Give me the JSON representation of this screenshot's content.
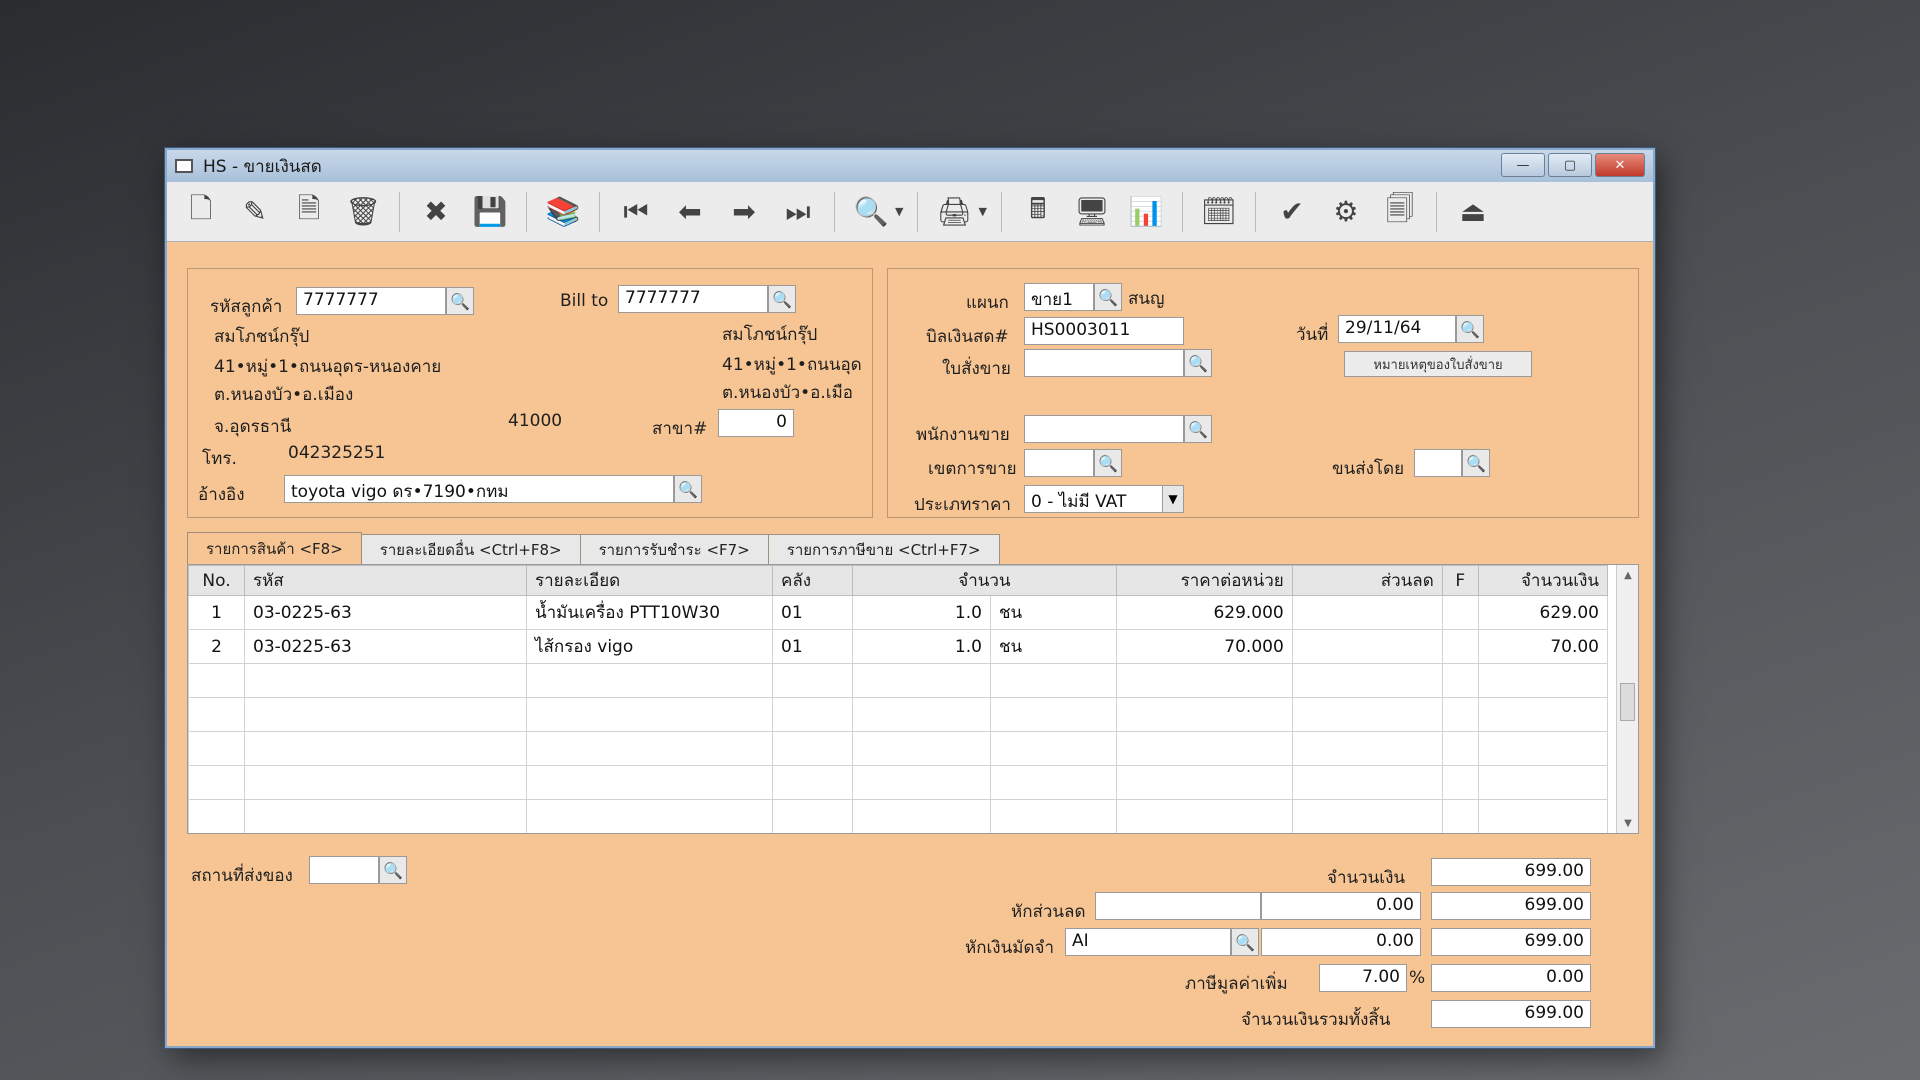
{
  "window": {
    "title": "HS - ขายเงินสด",
    "min_label": "—",
    "max_label": "▢",
    "close_label": "✕"
  },
  "toolbar": {
    "buttons": [
      {
        "name": "new-doc-icon",
        "glyph": "🗋"
      },
      {
        "name": "edit-icon",
        "glyph": "✎"
      },
      {
        "name": "void-icon",
        "glyph": "🗎"
      },
      {
        "name": "trash-icon",
        "glyph": "🗑"
      },
      {
        "name": "cancel-icon",
        "glyph": "✖"
      },
      {
        "name": "save-icon",
        "glyph": "💾"
      },
      {
        "name": "books-icon",
        "glyph": "📚"
      },
      {
        "name": "first-record-icon",
        "glyph": "⏮"
      },
      {
        "name": "prev-record-icon",
        "glyph": "⬅"
      },
      {
        "name": "next-record-icon",
        "glyph": "➡"
      },
      {
        "name": "last-record-icon",
        "glyph": "⏭"
      },
      {
        "name": "find-icon",
        "glyph": "🔍"
      },
      {
        "name": "print-icon",
        "glyph": "🖨"
      },
      {
        "name": "calculator-icon",
        "glyph": "🖩"
      },
      {
        "name": "register-icon",
        "glyph": "🖥"
      },
      {
        "name": "chart-icon",
        "glyph": "📊"
      },
      {
        "name": "report-icon",
        "glyph": "🗓"
      },
      {
        "name": "approve-icon",
        "glyph": "✔"
      },
      {
        "name": "stamp-icon",
        "glyph": "⚙"
      },
      {
        "name": "ok-doc-icon",
        "glyph": "🗐"
      },
      {
        "name": "exit-icon",
        "glyph": "⏏"
      }
    ]
  },
  "customer": {
    "code_label": "รหัสลูกค้า",
    "code_value": "7777777",
    "name": "สมโภชน์กรุ๊ป",
    "address1": "41•หมู่•1•ถนนอุดร-หนองคาย",
    "address2": "ต.หนองบัว•อ.เมือง",
    "province": "จ.อุดรธานี",
    "postcode": "41000",
    "phone_label": "โทร.",
    "phone_value": "042325251",
    "ref_label": "อ้างอิง",
    "ref_value": "toyota vigo ดร•7190•กทม"
  },
  "billto": {
    "label": "Bill to",
    "value": "7777777",
    "name": "สมโภชน์กรุ๊ป",
    "address1": "41•หมู่•1•ถนนอุด",
    "address2": "ต.หนองบัว•อ.เมือ",
    "branch_label": "สาขา#",
    "branch_value": "0"
  },
  "doc": {
    "dept_label": "แผนก",
    "dept_value": "ขาย1",
    "dept_name": "สนญ",
    "bill_label": "บิลเงินสด#",
    "bill_value": "HS0003011",
    "date_label": "วันที่",
    "date_value": "29/11/64",
    "so_label": "ใบสั่งขาย",
    "so_value": "",
    "so_note_btn": "หมายเหตุของใบสั่งขาย",
    "salesman_label": "พนักงานขาย",
    "salesman_value": "",
    "zone_label": "เขตการขาย",
    "zone_value": "",
    "ship_label": "ขนส่งโดย",
    "ship_value": "",
    "pricetype_label": "ประเภทราคา",
    "pricetype_value": "0 - ไม่มี VAT"
  },
  "tabs": [
    {
      "label": "รายการสินค้า <F8>"
    },
    {
      "label": "รายละเอียดอื่น <Ctrl+F8>"
    },
    {
      "label": "รายการรับชำระ <F7>"
    },
    {
      "label": "รายการภาษีขาย <Ctrl+F7>"
    }
  ],
  "grid": {
    "headers": {
      "no": "No.",
      "code": "รหัส",
      "desc": "รายละเอียด",
      "wh": "คลัง",
      "qty": "จำนวน",
      "unit_price": "ราคาต่อหน่วย",
      "discount": "ส่วนลด",
      "f": "F",
      "amount": "จำนวนเงิน"
    },
    "rows": [
      {
        "no": "1",
        "code": "03-0225-63",
        "desc": "น้ำมันเครื่อง PTT10W30",
        "wh": "01",
        "qty": "1.0",
        "unit": "ชน",
        "unit_price": "629.000",
        "discount": "",
        "f": "",
        "amount": "629.00"
      },
      {
        "no": "2",
        "code": "03-0225-63",
        "desc": "ไส้กรอง vigo",
        "wh": "01",
        "qty": "1.0",
        "unit": "ชน",
        "unit_price": "70.000",
        "discount": "",
        "f": "",
        "amount": "70.00"
      }
    ]
  },
  "footer": {
    "delivery_label": "สถานที่ส่งของ",
    "delivery_value": "",
    "amount_label": "จำนวนเงิน",
    "amount_value": "699.00",
    "discount_label": "หักส่วนลด",
    "discount_text": "",
    "discount_amt": "0.00",
    "discount_total": "699.00",
    "deposit_label": "หักเงินมัดจำ",
    "deposit_code": "AI",
    "deposit_amt": "0.00",
    "deposit_total": "699.00",
    "vat_label": "ภาษีมูลค่าเพิ่ม",
    "vat_rate": "7.00",
    "vat_pct": "%",
    "vat_amt": "0.00",
    "grand_label": "จำนวนเงินรวมทั้งสิ้น",
    "grand_value": "699.00"
  }
}
